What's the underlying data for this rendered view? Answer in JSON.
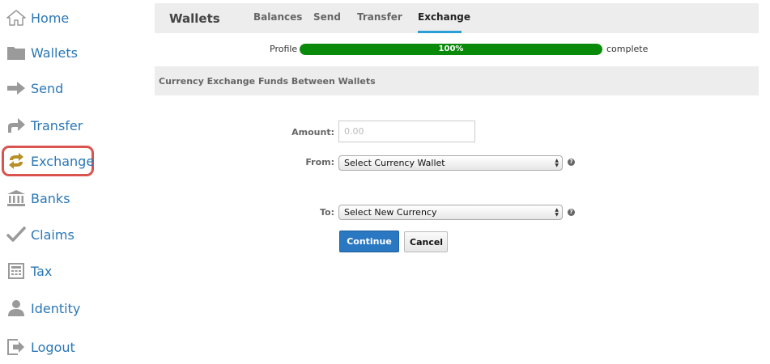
{
  "sidebar": {
    "items": [
      {
        "label": "Home",
        "icon": "home-icon"
      },
      {
        "label": "Wallets",
        "icon": "folder-icon"
      },
      {
        "label": "Send",
        "icon": "arrow-right-icon"
      },
      {
        "label": "Transfer",
        "icon": "transfer-arrow-icon"
      },
      {
        "label": "Exchange",
        "icon": "exchange-icon",
        "active": true
      },
      {
        "label": "Banks",
        "icon": "bank-icon"
      },
      {
        "label": "Claims",
        "icon": "checkmark-icon"
      },
      {
        "label": "Tax",
        "icon": "calculator-icon"
      },
      {
        "label": "Identity",
        "icon": "person-icon"
      },
      {
        "label": "Logout",
        "icon": "logout-icon"
      }
    ],
    "active_border_color": "#d9534f",
    "label_color": "#2a77b6"
  },
  "header": {
    "title": "Wallets",
    "tabs": [
      {
        "label": "Balances"
      },
      {
        "label": "Send"
      },
      {
        "label": "Transfer"
      },
      {
        "label": "Exchange",
        "active": true
      }
    ],
    "active_tab_color": "#2a9fd6"
  },
  "profile": {
    "label": "Profile",
    "progress_text": "100%",
    "progress_value": 100,
    "suffix": "complete",
    "bar_color": "#0a8a0a"
  },
  "section": {
    "title": "Currency Exchange Funds Between Wallets"
  },
  "form": {
    "amount_label": "Amount:",
    "amount_placeholder": "0.00",
    "from_label": "From:",
    "from_value": "Select Currency Wallet",
    "to_label": "To:",
    "to_value": "Select New Currency",
    "help_icon": "question-circle-icon",
    "continue_label": "Continue",
    "cancel_label": "Cancel",
    "continue_color": "#2a77c2"
  }
}
